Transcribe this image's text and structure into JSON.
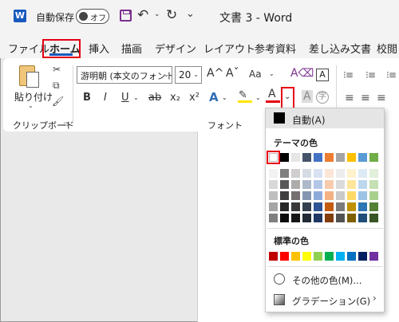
{
  "titlebar": {
    "app_icon": "word-app-icon",
    "autosave_label": "自動保存",
    "autosave_state": "オフ",
    "undo_icon": "↶",
    "dropdown_glyph": "⌄",
    "redo_icon": "↻",
    "qat_more_icon": "⌄",
    "doc_title": "文書 3  -  Word"
  },
  "tabs": [
    {
      "label": "ファイル"
    },
    {
      "label": "ホーム",
      "active": true
    },
    {
      "label": "挿入"
    },
    {
      "label": "描画"
    },
    {
      "label": "デザイン"
    },
    {
      "label": "レイアウト"
    },
    {
      "label": "参考資料"
    },
    {
      "label": "差し込み文書"
    },
    {
      "label": "校閲"
    }
  ],
  "clipboard": {
    "paste_label": "貼り付け",
    "paste_chevron": "⌄",
    "cut_icon": "✂",
    "copy_icon": "⧉",
    "format_painter_icon": "🖌",
    "group_label": "クリップボード",
    "launcher_icon": "⧄"
  },
  "font": {
    "font_name": "游明朝 (本文のフォント",
    "font_size": "20",
    "chevron": "⌄",
    "grow_icon": "A^",
    "shrink_icon": "Aˇ",
    "case_icon": "Aa",
    "clear_format_icon": "A⌫",
    "char_border_icon": "A",
    "bold": "B",
    "italic": "I",
    "underline": "U",
    "strike": "ab",
    "subscript": "x₂",
    "superscript": "x²",
    "text_effect": "A",
    "highlight_icon": "✎",
    "font_color": "A",
    "font_color_drop": "⌄",
    "char_shading": "A",
    "enclose_char": "字",
    "group_label": "フォント",
    "font_color_value": "#e60012",
    "highlight_value": "#ffe600"
  },
  "paragraph": {
    "bullets_icon": "⁝≡",
    "numbering_icon": "⁝≡",
    "multilevel_icon": "⁝≡",
    "align_icon": "≡"
  },
  "color_menu": {
    "auto_label": "自動(A)",
    "auto_color": "#000000",
    "theme_title": "テーマの色",
    "theme_top": [
      "#ffffff",
      "#000000",
      "#e7e6e6",
      "#44546a",
      "#4472c4",
      "#ed7d31",
      "#a5a5a5",
      "#ffc000",
      "#5b9bd5",
      "#70ad47"
    ],
    "theme_shades": [
      [
        "#f2f2f2",
        "#7f7f7f",
        "#d0cece",
        "#d6dce4",
        "#d9e2f3",
        "#fbe5d5",
        "#ededed",
        "#fff2cc",
        "#deebf6",
        "#e2efd9"
      ],
      [
        "#d8d8d8",
        "#595959",
        "#aeabab",
        "#adb9ca",
        "#b4c6e7",
        "#f7cbac",
        "#dbdbdb",
        "#fee599",
        "#bdd7ee",
        "#c5e0b3"
      ],
      [
        "#bfbfbf",
        "#3f3f3f",
        "#757070",
        "#8496b0",
        "#8eaadb",
        "#f4b183",
        "#c9c9c9",
        "#ffd965",
        "#9cc3e5",
        "#a8d08d"
      ],
      [
        "#a5a5a5",
        "#262626",
        "#3a3838",
        "#333f4f",
        "#2f5496",
        "#c55a11",
        "#7b7b7b",
        "#bf9000",
        "#2e75b5",
        "#538135"
      ],
      [
        "#7f7f7f",
        "#0c0c0c",
        "#171616",
        "#222a35",
        "#1f3864",
        "#833c0b",
        "#525252",
        "#7f6000",
        "#1e4e79",
        "#375623"
      ]
    ],
    "standard_title": "標準の色",
    "standard": [
      "#c00000",
      "#ff0000",
      "#ffc000",
      "#ffff00",
      "#92d050",
      "#00b050",
      "#00b0f0",
      "#0070c0",
      "#002060",
      "#7030a0"
    ],
    "more_colors_label": "その他の色(M)...",
    "gradient_label": "グラデーション(G)",
    "submenu_arrow": "›",
    "highlight_color": "#e60012"
  }
}
